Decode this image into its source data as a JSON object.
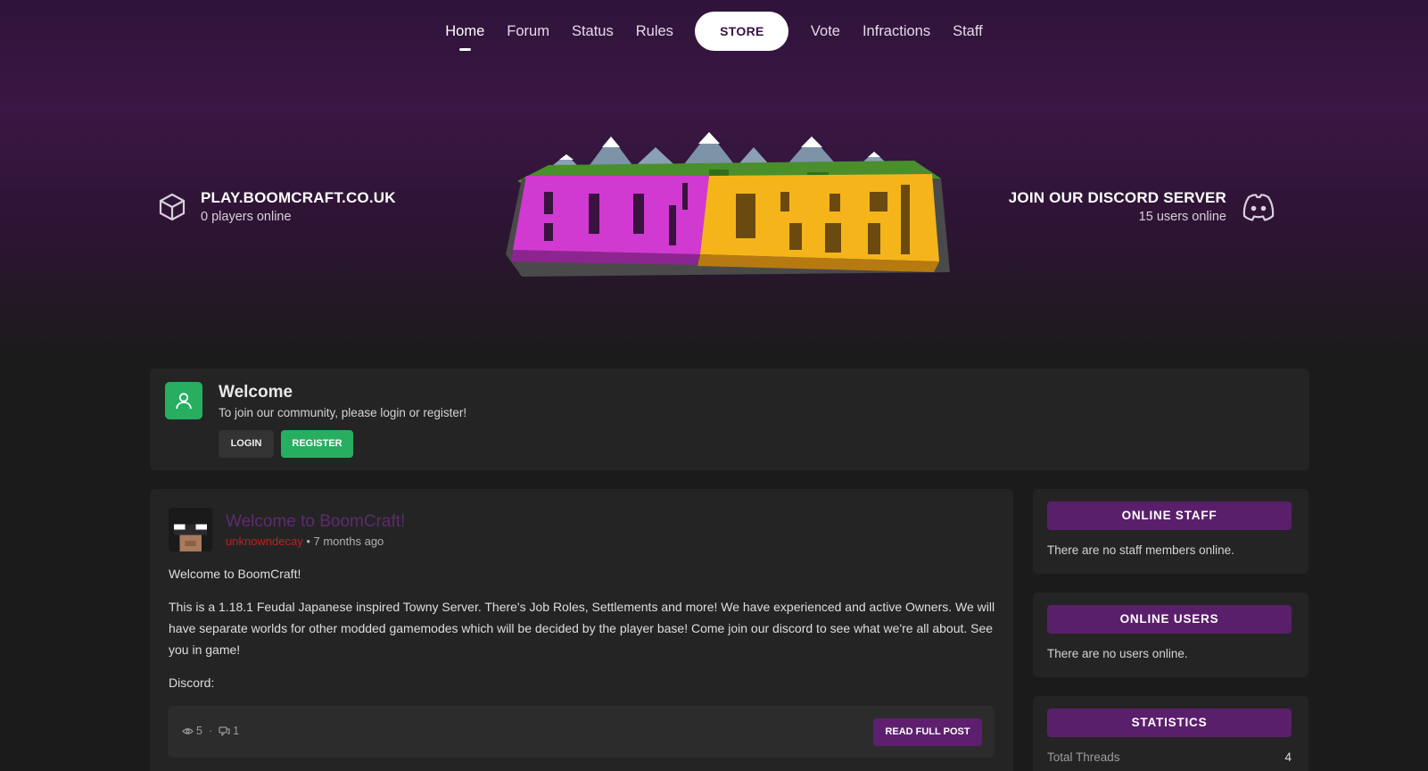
{
  "nav": {
    "items": [
      {
        "label": "Home",
        "active": true
      },
      {
        "label": "Forum"
      },
      {
        "label": "Status"
      },
      {
        "label": "Rules"
      }
    ],
    "store_label": "STORE",
    "items_right": [
      {
        "label": "Vote"
      },
      {
        "label": "Infractions"
      },
      {
        "label": "Staff"
      }
    ]
  },
  "server": {
    "address": "PLAY.BOOMCRAFT.CO.UK",
    "players": "0 players online",
    "icon": "cube-icon"
  },
  "discord": {
    "title": "JOIN OUR DISCORD SERVER",
    "users": "15 users online",
    "icon": "discord-icon"
  },
  "logo": {
    "text_left": "BOOM",
    "text_right": "CRAFT"
  },
  "welcome": {
    "title": "Welcome",
    "subtitle": "To join our community, please login or register!",
    "login_label": "LOGIN",
    "register_label": "REGISTER",
    "icon": "user-icon"
  },
  "post": {
    "title": "Welcome to BoomCraft!",
    "author": "unknowndecay",
    "separator": " • ",
    "time": "7 months ago",
    "paragraphs": [
      "Welcome to BoomCraft!",
      "This is a 1.18.1 Feudal Japanese inspired Towny Server. There's Job Roles, Settlements and more! We have experienced and active Owners. We will have separate worlds for other modded gamemodes which will be decided by the player base! Come join our discord to see what we're all about. See you in game!",
      "Discord:"
    ],
    "views": "5",
    "dot": "·",
    "comments": "1",
    "read_more_label": "READ FULL POST"
  },
  "sidebar": {
    "online_staff": {
      "title": "ONLINE STAFF",
      "text": "There are no staff members online."
    },
    "online_users": {
      "title": "ONLINE USERS",
      "text": "There are no users online."
    },
    "statistics": {
      "title": "STATISTICS",
      "rows": [
        {
          "label": "Total Threads",
          "value": "4"
        }
      ]
    }
  },
  "colors": {
    "accent": "#5a1f6a",
    "success": "#27ae60",
    "author": "#c41e1e",
    "post_title": "#5e2b6f",
    "logo_pink": "#d13ad1",
    "logo_yellow": "#f5b51a"
  }
}
